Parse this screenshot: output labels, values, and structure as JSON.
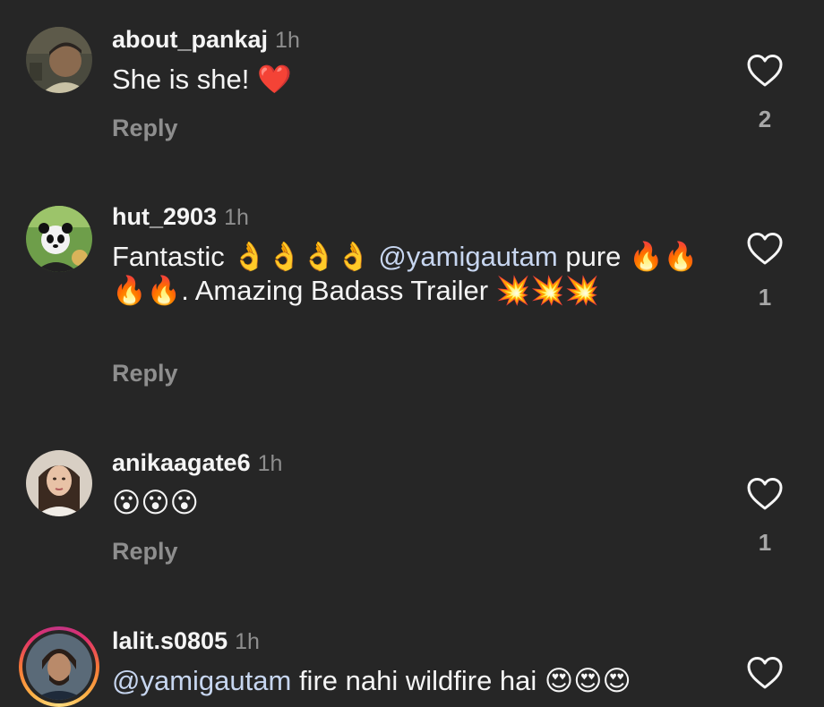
{
  "colors": {
    "background": "#262626",
    "text": "#f5f5f5",
    "muted": "#8e8e8e",
    "mention": "#c7d6f0"
  },
  "comments": [
    {
      "username": "about_pankaj",
      "time": "1h",
      "text": "She is she! ❤️",
      "reply_label": "Reply",
      "like_count": "2",
      "avatar_icon": "person-avatar"
    },
    {
      "username": "hut_2903",
      "time": "1h",
      "text_parts": {
        "p1": "Fantastic 👌👌👌👌 ",
        "mention": "@yamigautam",
        "p2": " pure 🔥🔥🔥🔥. Amazing Badass Trailer 💥💥💥"
      },
      "reply_label": "Reply",
      "like_count": "1",
      "avatar_icon": "panda-avatar"
    },
    {
      "username": "anikaagate6",
      "time": "1h",
      "text": "😮😮😮",
      "reply_label": "Reply",
      "like_count": "1",
      "avatar_icon": "person-avatar"
    },
    {
      "username": "lalit.s0805",
      "time": "1h",
      "text_parts": {
        "mention": "@yamigautam",
        "p2": " fire nahi wildfire hai 😍😍😍"
      },
      "avatar_icon": "person-avatar-story"
    }
  ]
}
